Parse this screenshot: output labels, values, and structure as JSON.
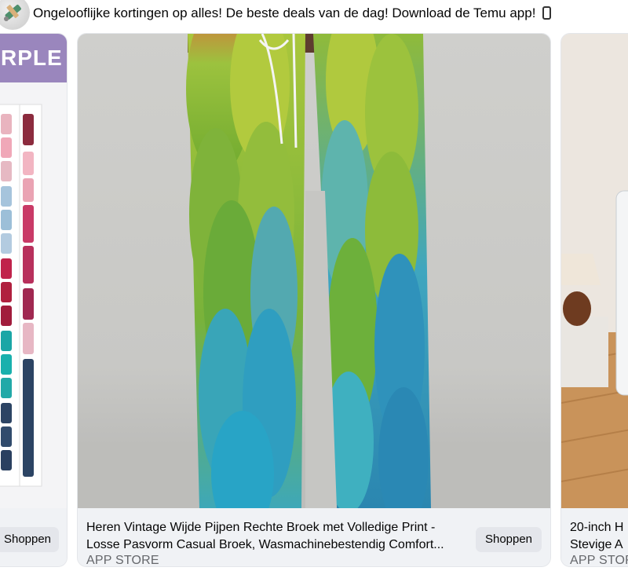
{
  "ad_header": {
    "text": "Ongelooflijke kortingen op alles! De beste deals van de dag! Download de Temu app!"
  },
  "cards": {
    "left": {
      "banner_text": "RPLE",
      "button_label": "Shoppen"
    },
    "main": {
      "title_line1": "Heren Vintage Wijde Pijpen Rechte Broek met Volledige Print -",
      "title_line2": "Losse Pasvorm Casual Broek, Wasmachinebestendig Comfort...",
      "subtitle": "APP STORE",
      "button_label": "Shoppen"
    },
    "right": {
      "title_line1": "20-inch H",
      "title_line2": "Stevige A",
      "subtitle": "APP STOR"
    }
  },
  "colors": {
    "button_bg": "#e4e6eb",
    "card_info_bg": "#f0f2f5",
    "banner_purple": "#9a86bd"
  },
  "icons": [
    "app-avatar-icon",
    "phone-icon"
  ]
}
